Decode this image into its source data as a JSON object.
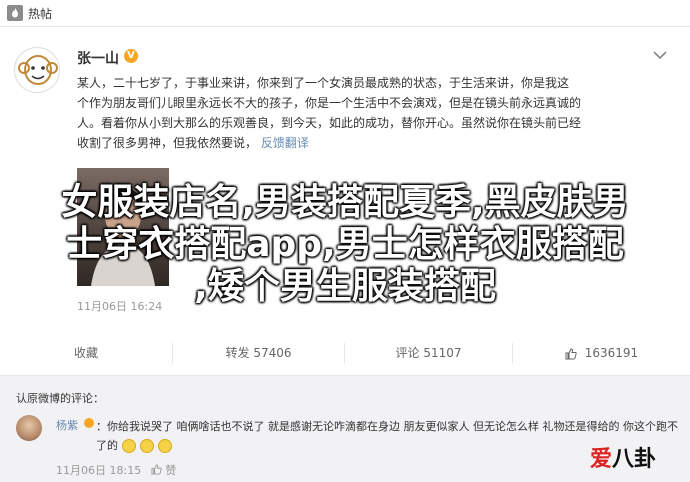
{
  "topbar": {
    "title": "热帖"
  },
  "post": {
    "author": "张一山",
    "badge": "V",
    "body_lines": [
      "某人，二十七岁了，于事业来讲，你来到了一个女演员最成熟的状态，于生活来讲，你是我这",
      "个作为朋友哥们儿眼里永远长不大的孩子，你是一个生活中不会演戏，但是在镜头前永远真诚的",
      "人。看着你从小到大那么的乐观善良，到今天，如此的成功，替你开心。虽然说你在镜头前已经"
    ],
    "last_line": "收割了很多男神，但我依然要说，",
    "translate": "反馈翻译",
    "time": "11月06日  16:24"
  },
  "overlay": {
    "lines": [
      "女服装店名,男装搭配夏季,黑皮肤男",
      "士穿衣搭配app,男士怎样衣服搭配",
      ",矮个男生服装搭配"
    ]
  },
  "actions": {
    "favorite": "收藏",
    "repost": "转发 57406",
    "comment": "评论 51107",
    "like": "1636191"
  },
  "comments": {
    "header": "认原微博的评论：",
    "user": "杨紫",
    "text": "：你给我说哭了 咱俩啥话也不说了 就是感谢无论咋滴都在身边 朋友更似家人 但无论怎么样 礼物还是得给的 你这个跑不了的",
    "time": "11月06日  18:15",
    "like_label": "赞"
  },
  "watermark": {
    "a": "爱",
    "b": "八卦"
  }
}
